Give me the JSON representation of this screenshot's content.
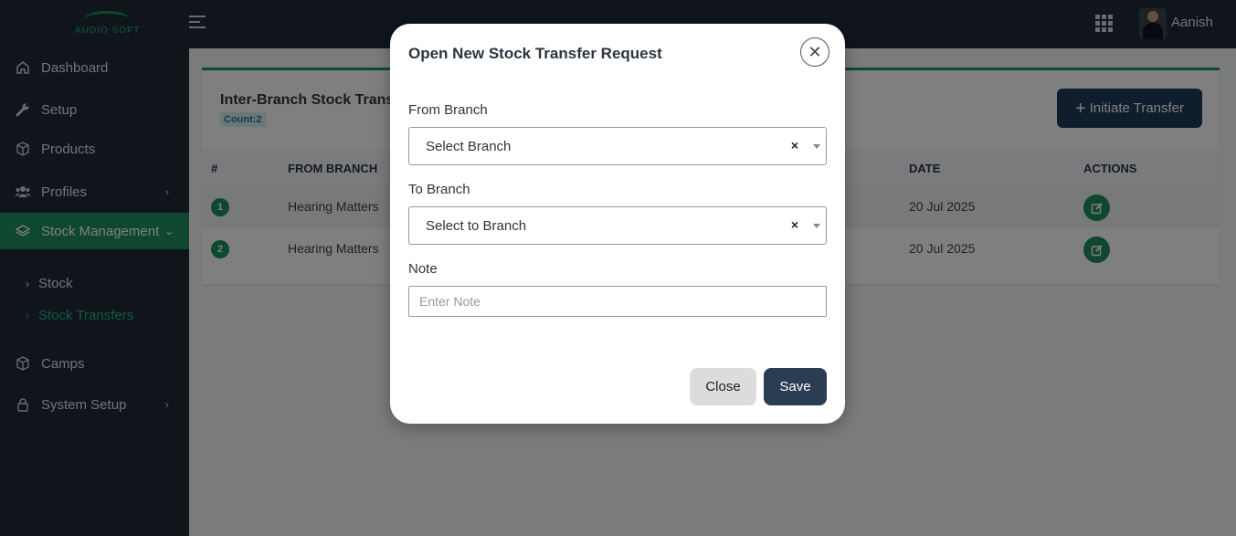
{
  "brand": {
    "logo_text": "AUDIO SOFT"
  },
  "colors": {
    "sidebar_bg": "#1e2a36",
    "accent": "#1f8f62",
    "primary_button": "#1e3a5a",
    "save_button": "#2b3d52"
  },
  "sidebar": {
    "items": [
      {
        "label": "Dashboard",
        "icon": "home-icon"
      },
      {
        "label": "Setup",
        "icon": "wrench-icon"
      },
      {
        "label": "Products",
        "icon": "box-icon"
      },
      {
        "label": "Profiles",
        "icon": "users-icon"
      },
      {
        "label": "Stock Management",
        "icon": "layers-icon",
        "active": true
      },
      {
        "label": "Camps",
        "icon": "box-icon"
      },
      {
        "label": "System Setup",
        "icon": "lock-icon"
      }
    ],
    "subitems": [
      {
        "label": "Stock"
      },
      {
        "label": "Stock Transfers",
        "active": true
      }
    ]
  },
  "header": {
    "username": "Aanish"
  },
  "page": {
    "card_title": "Inter-Branch Stock Transfers",
    "count_label": "Count:2",
    "initiate_button": "Initiate Transfer",
    "columns": [
      "#",
      "FROM BRANCH",
      "DATE",
      "ACTIONS"
    ],
    "rows": [
      {
        "num": "1",
        "from_branch": "Hearing Matters",
        "date": "20 Jul 2025"
      },
      {
        "num": "2",
        "from_branch": "Hearing Matters",
        "date": "20 Jul 2025"
      }
    ]
  },
  "modal": {
    "title": "Open New Stock Transfer Request",
    "from_label": "From Branch",
    "from_value": "Select Branch",
    "to_label": "To Branch",
    "to_value": "Select to Branch",
    "note_label": "Note",
    "note_placeholder": "Enter Note",
    "close_label": "Close",
    "save_label": "Save"
  }
}
